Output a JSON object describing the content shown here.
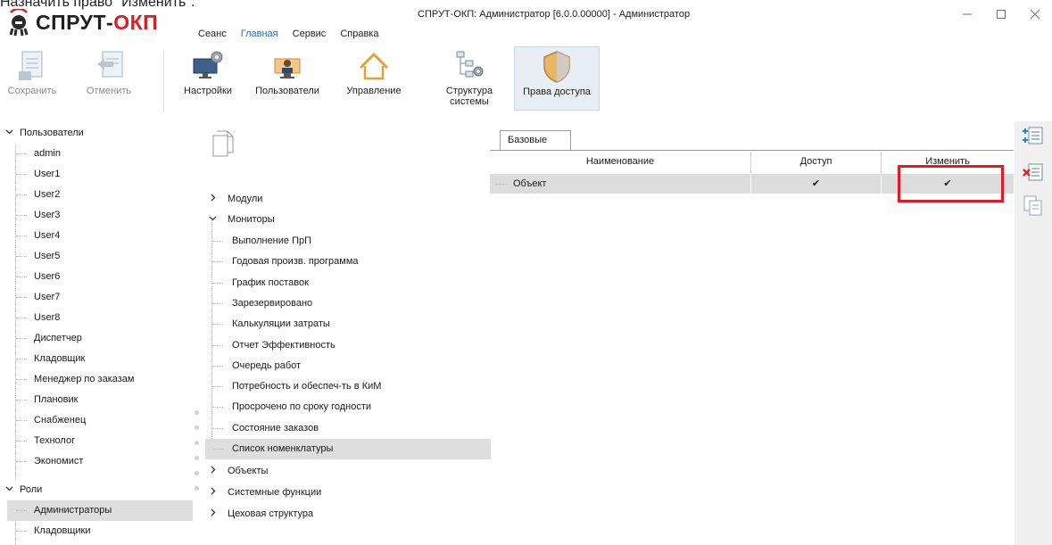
{
  "top_caption": "Назначить право \"Изменить\":",
  "app": {
    "logo_left": "СПРУТ-",
    "logo_right": "ОКП",
    "window_title": "СПРУТ-ОКП: Администратор [6.0.0.00000] - Администратор"
  },
  "menu": [
    "Сеанс",
    "Главная",
    "Сервис",
    "Справка"
  ],
  "window_controls": [
    "minimize-icon",
    "maximize-icon",
    "close-icon"
  ],
  "ribbon": {
    "save": "Сохранить",
    "cancel": "Отменить",
    "settings": "Настройки",
    "users": "Пользователи",
    "management": "Управление",
    "structure": "Структура\nсистемы",
    "access_rights": "Права доступа"
  },
  "left_tree": {
    "users_group": "Пользователи",
    "users": [
      "admin",
      "User1",
      "User2",
      "User3",
      "User4",
      "User5",
      "User6",
      "User7",
      "User8",
      "Диспетчер",
      "Кладовщик",
      "Менеджер по заказам",
      "Плановик",
      "Снабженец",
      "Технолог",
      "Экономист"
    ],
    "roles_group": "Роли",
    "roles": [
      "Администраторы",
      "Кладовщики"
    ]
  },
  "middle_tree": {
    "modules": "Модули",
    "monitors": "Мониторы",
    "monitor_items": [
      "Выполнение ПрП",
      "Годовая произв. программа",
      "График поставок",
      "Зарезервировано",
      "Калькуляции затраты",
      "Отчет  Эффективность",
      "Очередь работ",
      "Потребность и обеспеч-ть в КиМ",
      "Просрочено по сроку годности",
      "Состояние заказов",
      "Список номенклатуры"
    ],
    "objects": "Объекты",
    "system_functions": "Системные функции",
    "shop_structure": "Цеховая структура"
  },
  "rights_panel": {
    "tab": "Базовые",
    "columns": [
      "Наименование",
      "Доступ",
      "Изменить"
    ],
    "row": {
      "name": "Объект",
      "access": "✔",
      "edit": "✔"
    }
  },
  "colors": {
    "highlight": "#e01b24",
    "brand_red": "#d81f26",
    "selection": "#dedede"
  }
}
